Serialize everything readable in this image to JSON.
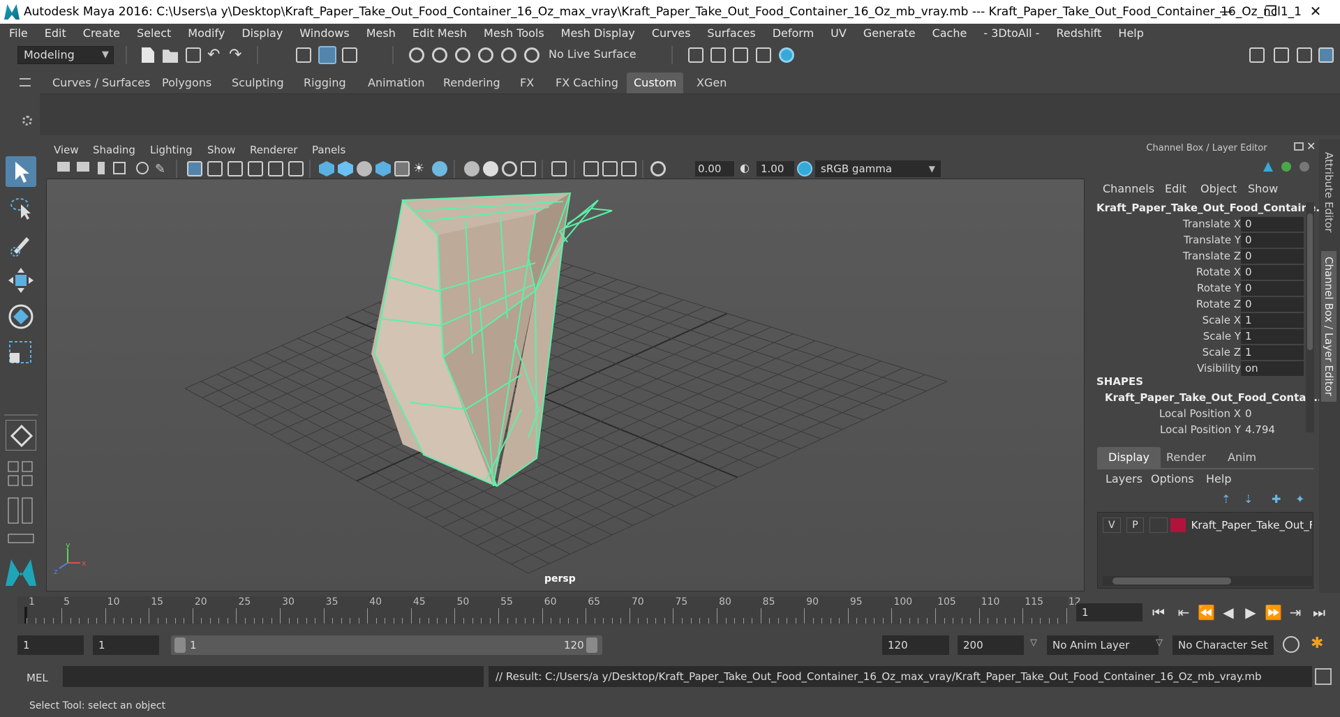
{
  "window": {
    "title": "Autodesk Maya 2016: C:\\Users\\a y\\Desktop\\Kraft_Paper_Take_Out_Food_Container_16_Oz_max_vray\\Kraft_Paper_Take_Out_Food_Container_16_Oz_mb_vray.mb   ---   Kraft_Paper_Take_Out_Food_Container_16_Oz_ncl1_1",
    "minimize": "—",
    "restore": "❐",
    "close": "✕"
  },
  "menubar": [
    "File",
    "Edit",
    "Create",
    "Select",
    "Modify",
    "Display",
    "Windows",
    "Mesh",
    "Edit Mesh",
    "Mesh Tools",
    "Mesh Display",
    "Curves",
    "Surfaces",
    "Deform",
    "UV",
    "Generate",
    "Cache",
    "- 3DtoAll -",
    "Redshift",
    "Help"
  ],
  "statusline": {
    "mode": "Modeling",
    "live_surface": "No Live Surface"
  },
  "shelf": {
    "tabs": [
      "Curves / Surfaces",
      "Polygons",
      "Sculpting",
      "Rigging",
      "Animation",
      "Rendering",
      "FX",
      "FX Caching",
      "Custom",
      "XGen"
    ],
    "active_tab": "Custom"
  },
  "viewport": {
    "menu": [
      "View",
      "Shading",
      "Lighting",
      "Show",
      "Renderer",
      "Panels"
    ],
    "exposure": "0.00",
    "gamma": "1.00",
    "color_space": "sRGB gamma",
    "camera_label": "persp",
    "axis_labels": {
      "x": "x",
      "y": "y",
      "z": "z"
    }
  },
  "channel_box": {
    "title": "Channel Box / Layer Editor",
    "menu": [
      "Channels",
      "Edit",
      "Object",
      "Show"
    ],
    "object_name": "Kraft_Paper_Take_Out_Food_Containe...",
    "attributes": [
      {
        "label": "Translate X",
        "value": "0"
      },
      {
        "label": "Translate Y",
        "value": "0"
      },
      {
        "label": "Translate Z",
        "value": "0"
      },
      {
        "label": "Rotate X",
        "value": "0"
      },
      {
        "label": "Rotate Y",
        "value": "0"
      },
      {
        "label": "Rotate Z",
        "value": "0"
      },
      {
        "label": "Scale X",
        "value": "1"
      },
      {
        "label": "Scale Y",
        "value": "1"
      },
      {
        "label": "Scale Z",
        "value": "1"
      },
      {
        "label": "Visibility",
        "value": "on"
      }
    ],
    "shapes_label": "SHAPES",
    "shape_name": "Kraft_Paper_Take_Out_Food_Contai...",
    "shape_attributes": [
      {
        "label": "Local Position X",
        "value": "0"
      },
      {
        "label": "Local Position Y",
        "value": "4.794"
      }
    ]
  },
  "layer_editor": {
    "tabs": [
      "Display",
      "Render",
      "Anim"
    ],
    "active_tab": "Display",
    "menu": [
      "Layers",
      "Options",
      "Help"
    ],
    "layers": [
      {
        "v": "V",
        "p": "P",
        "color": "#b0143a",
        "name": "Kraft_Paper_Take_Out_Fo"
      }
    ]
  },
  "side_tabs": [
    "Attribute Editor",
    "Channel Box / Layer Editor"
  ],
  "timeline": {
    "ticks": [
      "1",
      "5",
      "10",
      "15",
      "20",
      "25",
      "30",
      "35",
      "40",
      "45",
      "50",
      "55",
      "60",
      "65",
      "70",
      "75",
      "80",
      "85",
      "90",
      "95",
      "100",
      "105",
      "110",
      "115",
      "12"
    ],
    "current_frame": "1",
    "playback_buttons": [
      "⏮",
      "⇤",
      "⏪",
      "◀",
      "▶",
      "⏩",
      "⇥",
      "⏭"
    ]
  },
  "range": {
    "start": "1",
    "playback_start": "1",
    "slider_start": "1",
    "slider_end": "120",
    "playback_end": "120",
    "end": "200",
    "anim_layer": "No Anim Layer",
    "character_set": "No Character Set"
  },
  "command_line": {
    "mode": "MEL",
    "result": "// Result: C:/Users/a y/Desktop/Kraft_Paper_Take_Out_Food_Container_16_Oz_max_vray/Kraft_Paper_Take_Out_Food_Container_16_Oz_mb_vray.mb"
  },
  "help_line": "Select Tool: select an object",
  "colors": {
    "wireframe": "#5cf0a8",
    "accent": "#5385ac",
    "layer_color": "#b0143a"
  }
}
